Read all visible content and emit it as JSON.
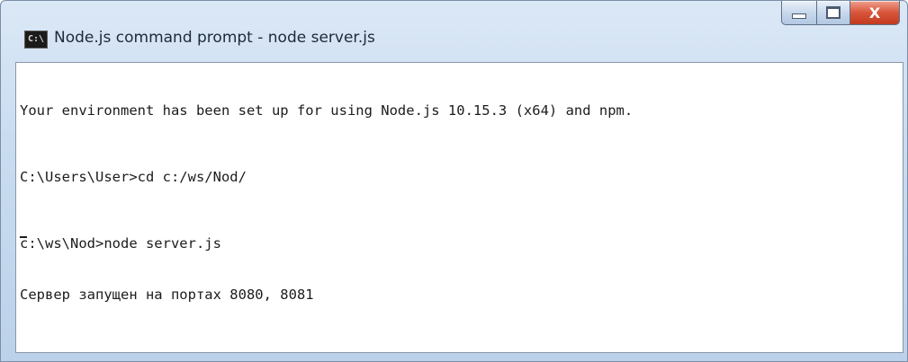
{
  "window": {
    "title": "Node.js command prompt - node server.js",
    "app_icon": "cmd-icon",
    "app_icon_label": "C:\\"
  },
  "caption_buttons": {
    "minimize_icon": "minimize-icon",
    "maximize_icon": "maximize-icon",
    "close_icon": "close-icon",
    "close_glyph": "X"
  },
  "console": {
    "lines": [
      "Your environment has been set up for using Node.js 10.15.3 (x64) and npm.",
      "C:\\Users\\User>cd c:/ws/Nod/",
      "c:\\ws\\Nod>node server.js",
      "Сервер запущен на портах 8080, 8081"
    ]
  },
  "colors": {
    "title_bar": "#c9dcf0",
    "close_button": "#d9553a",
    "console_background": "#ffffff",
    "console_text": "#1c1c1c"
  }
}
